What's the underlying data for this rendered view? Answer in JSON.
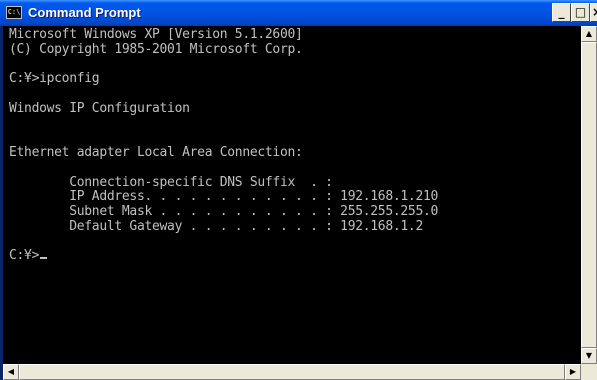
{
  "window": {
    "title": "Command Prompt",
    "icon": "cmd-icon",
    "icon_text": "C:\\",
    "controls": {
      "minimize": "_",
      "maximize": "□",
      "close": "×"
    }
  },
  "console": {
    "lines": [
      "Microsoft Windows XP [Version 5.1.2600]",
      "(C) Copyright 1985-2001 Microsoft Corp.",
      "",
      "C:¥>ipconfig",
      "",
      "Windows IP Configuration",
      "",
      "",
      "Ethernet adapter Local Area Connection:",
      "",
      "        Connection-specific DNS Suffix  . :",
      "        IP Address. . . . . . . . . . . . : 192.168.1.210",
      "        Subnet Mask . . . . . . . . . . . : 255.255.255.0",
      "        Default Gateway . . . . . . . . . : 192.168.1.2",
      "",
      "C:¥>"
    ],
    "text_color": "#c0c0c0",
    "background": "#000000"
  },
  "scrollbars": {
    "up_arrow": "▲",
    "down_arrow": "▼",
    "left_arrow": "◀",
    "right_arrow": "▶"
  }
}
